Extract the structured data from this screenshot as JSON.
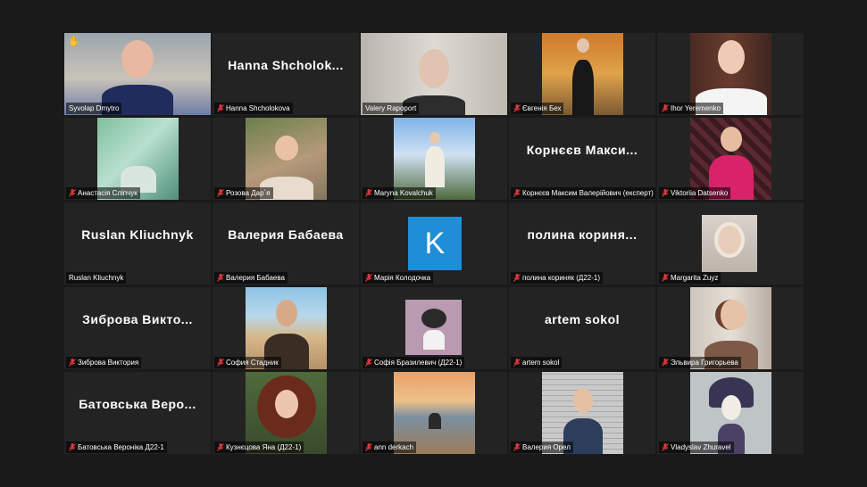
{
  "colors": {
    "background": "#1a1a1a",
    "tile": "#232323",
    "active_border": "#d6e25b",
    "muted_mic": "#e0393c",
    "k_avatar": "#1e8fd6"
  },
  "participants": [
    {
      "name": "Syvolap Dmytro",
      "muted": false,
      "active": true,
      "raised_hand": true
    },
    {
      "name": "Hanna Shcholokova",
      "display": "Hanna Shcholok...",
      "muted": true
    },
    {
      "name": "Valery Rapoport",
      "muted": false
    },
    {
      "name": "Євгенія Бех",
      "muted": true
    },
    {
      "name": "Ihor Yeremenko",
      "muted": true
    },
    {
      "name": "Анастасія Сліпчук",
      "muted": true
    },
    {
      "name": "Розова Дар`я",
      "muted": true
    },
    {
      "name": "Maryna Kovalchuk",
      "muted": true
    },
    {
      "name": "Корнєєв Максим Валерійович (експерт)",
      "display": "Корнєєв Макси...",
      "muted": true
    },
    {
      "name": "Viktoriia Datsenko",
      "muted": true
    },
    {
      "name": "Ruslan Kliuchnyk",
      "display": "Ruslan Kliuchnyk",
      "muted": false
    },
    {
      "name": "Валерия Бабаева",
      "display": "Валерия Бабаева",
      "muted": true
    },
    {
      "name": "Марія Колодочка",
      "avatar_letter": "K",
      "muted": true
    },
    {
      "name": "полина кориняк (Д22-1)",
      "display": "полина кориня...",
      "muted": true
    },
    {
      "name": "Margarita Zuyz",
      "muted": true
    },
    {
      "name": "Зиброва Виктория",
      "display": "Зиброва Викто...",
      "muted": true
    },
    {
      "name": "София Стадник",
      "muted": true
    },
    {
      "name": "Софія Бразилевич (Д22-1)",
      "muted": true
    },
    {
      "name": "artem sokol",
      "display": "artem sokol",
      "muted": true
    },
    {
      "name": "Эльвира Григорьева",
      "muted": true
    },
    {
      "name": "Батовська Вероніка Д22-1",
      "display": "Батовська Веро...",
      "muted": true
    },
    {
      "name": "Кузнєцова Яна (Д22-1)",
      "muted": true
    },
    {
      "name": "ann derkach",
      "muted": true
    },
    {
      "name": "Валерия Орел",
      "muted": true
    },
    {
      "name": "Vladyslav Zhuravel",
      "muted": true
    }
  ]
}
